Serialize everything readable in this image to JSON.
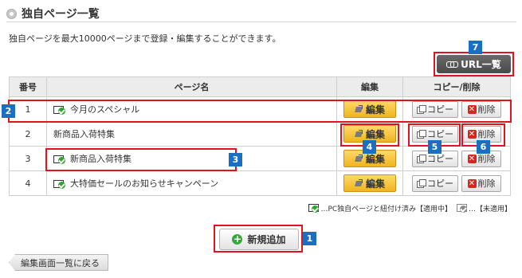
{
  "page": {
    "title": "独自ページ一覧",
    "description": "独自ページを最大10000ページまで登録・編集することができます。"
  },
  "url_button": {
    "label": "URL一覧"
  },
  "table": {
    "headers": {
      "number": "番号",
      "page_name": "ページ名",
      "edit": "編集",
      "copy_delete": "コピー/削除"
    },
    "rows": [
      {
        "number": "1",
        "name": "今月のスペシャル",
        "linked": true
      },
      {
        "number": "2",
        "name": "新商品入荷特集",
        "linked": false
      },
      {
        "number": "3",
        "name": "新商品入荷特集",
        "linked": true
      },
      {
        "number": "4",
        "name": "大特価セールのお知らせキャンペーン",
        "linked": true
      }
    ],
    "edit_label": "編集",
    "copy_label": "コピー",
    "delete_label": "削除"
  },
  "legend": {
    "linked": "…PC独自ページと紐付け済み【適用中】",
    "unlinked": "…【未適用】"
  },
  "new_button": {
    "label": "新規追加"
  },
  "back_button": {
    "label": "編集画面一覧に戻る"
  },
  "annotations": [
    "1",
    "2",
    "3",
    "4",
    "5",
    "6",
    "7"
  ],
  "colors": {
    "badge": "#1a6fc2",
    "highlight": "#e0141e",
    "edit_button": "#f0b51d"
  }
}
